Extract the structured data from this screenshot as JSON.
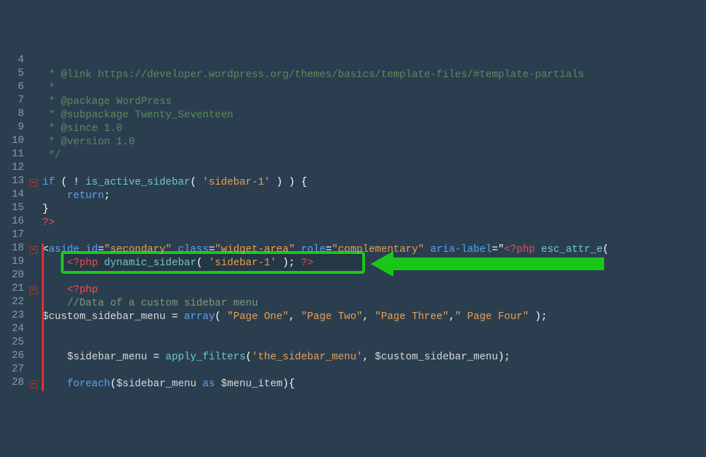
{
  "lines": {
    "4": {
      "n": "4"
    },
    "5": {
      "n": "5",
      "tokens": [
        [
          "c-comment",
          " * @link https://developer.wordpress.org/themes/basics/template-files/#template-partials"
        ]
      ]
    },
    "6": {
      "n": "6",
      "tokens": [
        [
          "c-comment",
          " *"
        ]
      ]
    },
    "7": {
      "n": "7",
      "tokens": [
        [
          "c-comment",
          " * @package WordPress"
        ]
      ]
    },
    "8": {
      "n": "8",
      "tokens": [
        [
          "c-comment",
          " * @subpackage Twenty_Seventeen"
        ]
      ]
    },
    "9": {
      "n": "9",
      "tokens": [
        [
          "c-comment",
          " * @since 1.0"
        ]
      ]
    },
    "10": {
      "n": "10",
      "tokens": [
        [
          "c-comment",
          " * @version 1.0"
        ]
      ]
    },
    "11": {
      "n": "11",
      "tokens": [
        [
          "c-comment",
          " */"
        ]
      ]
    },
    "12": {
      "n": "12"
    },
    "13": {
      "n": "13",
      "fold": true,
      "tokens": [
        [
          "c-keyword",
          "if"
        ],
        [
          "c-white",
          " ( ! "
        ],
        [
          "c-func",
          "is_active_sidebar"
        ],
        [
          "c-white",
          "( "
        ],
        [
          "c-string",
          "'sidebar-1'"
        ],
        [
          "c-white",
          " ) ) {"
        ]
      ]
    },
    "14": {
      "n": "14",
      "tokens": [
        [
          "",
          "    "
        ],
        [
          "c-keyword",
          "return"
        ],
        [
          "c-white",
          ";"
        ]
      ]
    },
    "15": {
      "n": "15",
      "tokens": [
        [
          "c-white",
          "}"
        ]
      ]
    },
    "16": {
      "n": "16",
      "tokens": [
        [
          "c-phptag",
          "?>"
        ]
      ]
    },
    "17": {
      "n": "17"
    },
    "18": {
      "n": "18",
      "fold": true,
      "changed": true,
      "tokens": [
        [
          "c-white",
          "<"
        ],
        [
          "c-keyword",
          "aside"
        ],
        [
          "c-white",
          " "
        ],
        [
          "c-keyword",
          "id"
        ],
        [
          "c-white",
          "="
        ],
        [
          "c-string",
          "\"secondary\""
        ],
        [
          "c-white",
          " "
        ],
        [
          "c-keyword",
          "class"
        ],
        [
          "c-white",
          "="
        ],
        [
          "c-string",
          "\"widget-area\""
        ],
        [
          "c-white",
          " "
        ],
        [
          "c-keyword",
          "role"
        ],
        [
          "c-white",
          "="
        ],
        [
          "c-string",
          "\"complementary\""
        ],
        [
          "c-white",
          " "
        ],
        [
          "c-keyword",
          "aria-label"
        ],
        [
          "c-white",
          "=\""
        ],
        [
          "c-phptag",
          "<?php"
        ],
        [
          "c-white",
          " "
        ],
        [
          "c-func",
          "esc_attr_e"
        ],
        [
          "c-white",
          "("
        ]
      ]
    },
    "19": {
      "n": "19",
      "changed": true,
      "tokens": [
        [
          "",
          "    "
        ],
        [
          "c-phptag",
          "<?php"
        ],
        [
          "c-white",
          " "
        ],
        [
          "c-func",
          "dynamic_sidebar"
        ],
        [
          "c-white",
          "( "
        ],
        [
          "c-string",
          "'sidebar-1'"
        ],
        [
          "c-white",
          " ); "
        ],
        [
          "c-phptag",
          "?>"
        ]
      ]
    },
    "20": {
      "n": "20",
      "changed": true
    },
    "21": {
      "n": "21",
      "fold": true,
      "changed": true,
      "tokens": [
        [
          "",
          "    "
        ],
        [
          "c-phptag",
          "<?php"
        ]
      ]
    },
    "22": {
      "n": "22",
      "changed": true,
      "tokens": [
        [
          "",
          "    "
        ],
        [
          "c-comment2",
          "//Data of a custom sidebar menu"
        ]
      ]
    },
    "23": {
      "n": "23",
      "changed": true,
      "tokens": [
        [
          "c-var",
          "$custom_sidebar_menu"
        ],
        [
          "c-white",
          " = "
        ],
        [
          "c-keyword",
          "array"
        ],
        [
          "c-white",
          "( "
        ],
        [
          "c-string",
          "\"Page One\""
        ],
        [
          "c-white",
          ", "
        ],
        [
          "c-string",
          "\"Page Two\""
        ],
        [
          "c-white",
          ", "
        ],
        [
          "c-string",
          "\"Page Three\""
        ],
        [
          "c-white",
          ","
        ],
        [
          "c-string",
          "\" Page Four\""
        ],
        [
          "c-white",
          " );"
        ]
      ]
    },
    "24": {
      "n": "24",
      "changed": true
    },
    "25": {
      "n": "25",
      "changed": true
    },
    "26": {
      "n": "26",
      "changed": true,
      "tokens": [
        [
          "",
          "    "
        ],
        [
          "c-var",
          "$sidebar_menu"
        ],
        [
          "c-white",
          " = "
        ],
        [
          "c-func",
          "apply_filters"
        ],
        [
          "c-white",
          "("
        ],
        [
          "c-string",
          "'the_sidebar_menu'"
        ],
        [
          "c-white",
          ", "
        ],
        [
          "c-var",
          "$custom_sidebar_menu"
        ],
        [
          "c-white",
          ");"
        ]
      ]
    },
    "27": {
      "n": "27",
      "changed": true
    },
    "28": {
      "n": "28",
      "fold": true,
      "changed": true,
      "tokens": [
        [
          "",
          "    "
        ],
        [
          "c-keyword",
          "foreach"
        ],
        [
          "c-white",
          "("
        ],
        [
          "c-var",
          "$sidebar_menu"
        ],
        [
          "c-white",
          " "
        ],
        [
          "c-keyword",
          "as"
        ],
        [
          "c-white",
          " "
        ],
        [
          "c-var",
          "$menu_item"
        ],
        [
          "c-white",
          "){"
        ]
      ]
    }
  },
  "first_line": 4,
  "last_line": 28,
  "annotation": {
    "highlight_line": 19,
    "arrow_target_line": 19
  }
}
